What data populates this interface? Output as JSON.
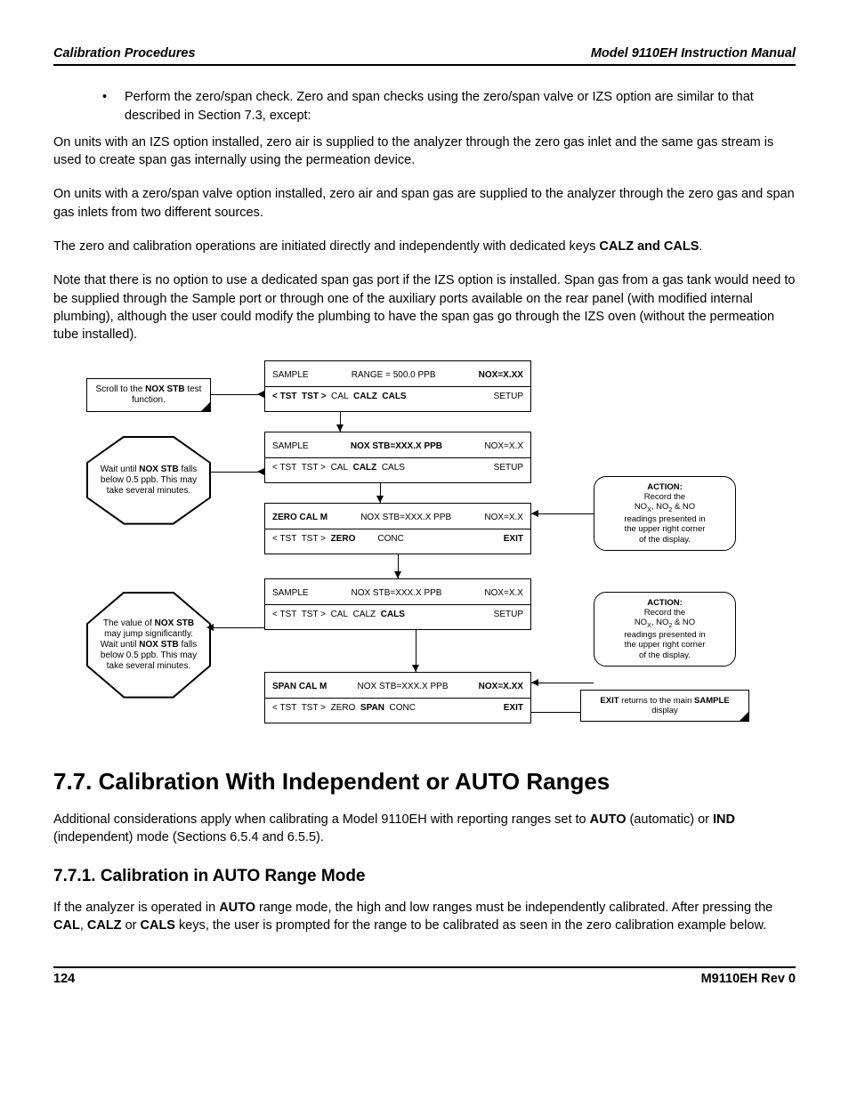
{
  "header": {
    "left": "Calibration Procedures",
    "right": "Model 9110EH Instruction Manual"
  },
  "bullet1": "Perform the zero/span check. Zero and span checks using the zero/span valve or IZS option are similar to that described in Section 7.3, except:",
  "para1": "On units with an IZS option installed, zero air is supplied to the analyzer through the zero gas inlet and the same gas stream is used to create span gas internally using the permeation device.",
  "para2": "On units with a zero/span valve option installed, zero air and span gas are supplied to the analyzer through the zero gas and span gas inlets from two different sources.",
  "para3_a": "The zero and calibration operations are initiated directly and independently with dedicated keys ",
  "para3_b": "CALZ and CALS",
  "para3_c": ".",
  "para4": "Note that there is no option to use a dedicated span gas port if the IZS option is installed. Span gas from a gas tank would need to be supplied through the Sample port or through one of the auxiliary ports available on the rear panel (with modified internal plumbing), although the user could modify the plumbing to have the span gas go through the IZS oven (without the permeation tube installed).",
  "h2": "7.7. Calibration With Independent or AUTO Ranges",
  "para5_a": "Additional considerations apply when calibrating a Model 9110EH with reporting ranges set to ",
  "para5_b": "AUTO",
  "para5_c": " (automatic) or ",
  "para5_d": "IND",
  "para5_e": " (independent) mode (Sections 6.5.4 and 6.5.5).",
  "h3": "7.7.1. Calibration in AUTO Range Mode",
  "para6_a": "If the analyzer is operated in ",
  "para6_b": "AUTO",
  "para6_c": " range mode, the high and low ranges must be independently calibrated. After pressing the ",
  "para6_d": "CAL",
  "para6_e": ", ",
  "para6_f": "CALZ",
  "para6_g": " or ",
  "para6_h": "CALS",
  "para6_i": " keys, the user is prompted for the range to be calibrated as seen in the zero calibration example below.",
  "footer": {
    "left": "124",
    "right": "M9110EH Rev 0"
  },
  "flow": {
    "note1_a": "Scroll to the ",
    "note1_b": "NOX STB",
    "note1_c": " test function.",
    "oct1_a": "Wait until ",
    "oct1_b": "NOX STB",
    "oct1_c": " falls below 0.5 ppb. This may take several minutes.",
    "oct2_a": "The value of ",
    "oct2_b": "NOX STB",
    "oct2_c": " may jump significantly. Wait until ",
    "oct2_d": "NOX STB",
    "oct2_e": " falls below 0.5 ppb. This may take several minutes.",
    "action_title": "ACTION:",
    "action_body": "Record the NOₓ, NO₂ & NO readings presented in the upper right corner of the display.",
    "exit_note_a": "EXIT",
    "exit_note_b": " returns to the main ",
    "exit_note_c": "SAMPLE",
    "exit_note_d": " display",
    "s1": {
      "l1a": "SAMPLE",
      "l1b": "RANGE = 500.0 PPB",
      "l1c": "NOX=X.XX",
      "l2": "< TST  TST >  CAL  CALZ  CALS",
      "l2r": "SETUP"
    },
    "s2": {
      "l1a": "SAMPLE",
      "l1b": "NOX STB=XXX.X PPB",
      "l1c": "NOX=X.X",
      "l2": "< TST  TST >  CAL  CALZ  CALS",
      "l2r": "SETUP"
    },
    "s3": {
      "l1a": "ZERO CAL M",
      "l1b": "NOX STB=XXX.X PPB",
      "l1c": "NOX=X.X",
      "l2": "< TST  TST >  ZERO          CONC",
      "l2r": "EXIT"
    },
    "s4": {
      "l1a": "SAMPLE",
      "l1b": "NOX STB=XXX.X PPB",
      "l1c": "NOX=X.X",
      "l2": "< TST  TST >  CAL  CALZ  CALS",
      "l2r": "SETUP"
    },
    "s5": {
      "l1a": "SPAN CAL M",
      "l1b": "NOX STB=XXX.X PPB",
      "l1c": "NOX=X.XX",
      "l2": "< TST  TST >  ZERO  SPAN  CONC",
      "l2r": "EXIT"
    }
  }
}
